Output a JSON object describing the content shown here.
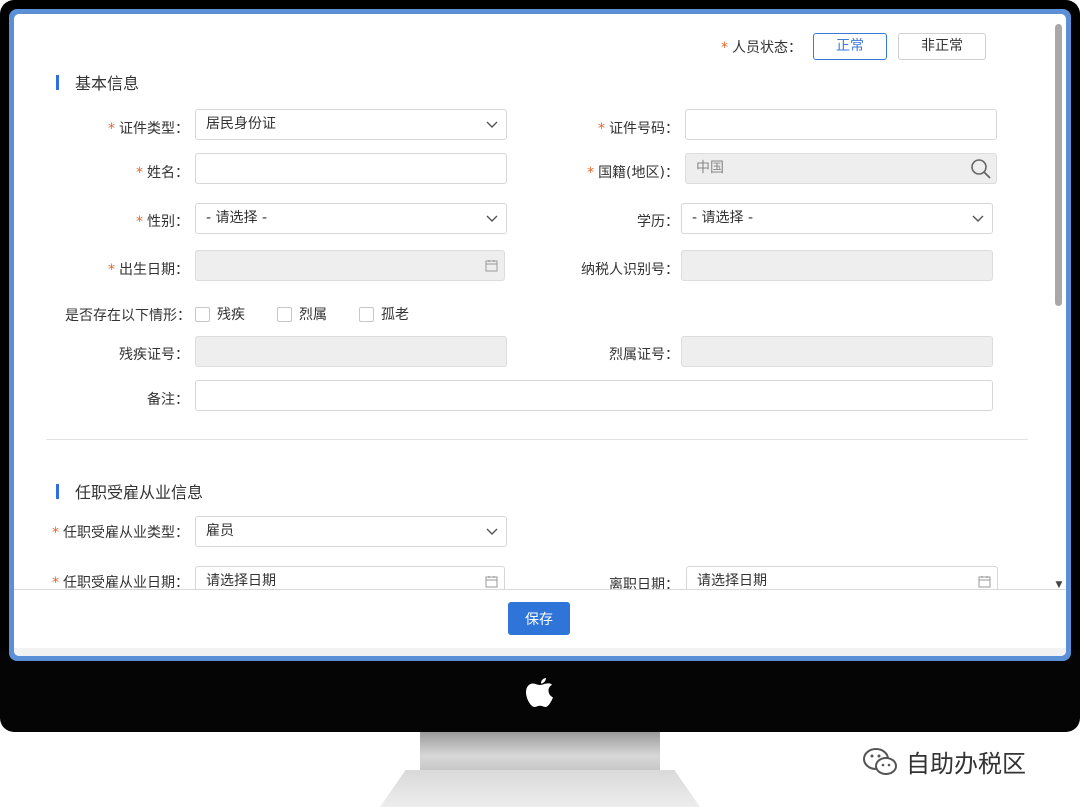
{
  "status": {
    "label": "人员状态：",
    "options": [
      "正常",
      "非正常"
    ],
    "selected": "正常"
  },
  "basic_info": {
    "title": "基本信息",
    "id_type": {
      "label": "证件类型：",
      "value": "居民身份证"
    },
    "id_number": {
      "label": "证件号码：",
      "value": ""
    },
    "name": {
      "label": "姓名：",
      "value": ""
    },
    "nationality": {
      "label": "国籍(地区)：",
      "value": "中国"
    },
    "gender": {
      "label": "性别：",
      "value": "- 请选择 -"
    },
    "education": {
      "label": "学历：",
      "value": "- 请选择 -"
    },
    "birth_date": {
      "label": "出生日期：",
      "value": ""
    },
    "taxpayer_id": {
      "label": "纳税人识别号：",
      "value": ""
    },
    "situations": {
      "label": "是否存在以下情形：",
      "options": [
        "残疾",
        "烈属",
        "孤老"
      ]
    },
    "disability_cert": {
      "label": "残疾证号：",
      "value": ""
    },
    "martyr_cert": {
      "label": "烈属证号：",
      "value": ""
    },
    "remarks": {
      "label": "备注：",
      "value": ""
    }
  },
  "employment_info": {
    "title": "任职受雇从业信息",
    "type": {
      "label": "任职受雇从业类型：",
      "value": "雇员"
    },
    "start_date": {
      "label": "任职受雇从业日期：",
      "placeholder": "请选择日期"
    },
    "leave_date": {
      "label": "离职日期：",
      "placeholder": "请选择日期"
    }
  },
  "footer": {
    "save_label": "保存"
  },
  "watermark": {
    "text": "自助办税区",
    "icon": "wechat-icon"
  },
  "colors": {
    "accent": "#2f74d8",
    "required": "#e5672a",
    "screen_border": "#5b8fd6"
  }
}
